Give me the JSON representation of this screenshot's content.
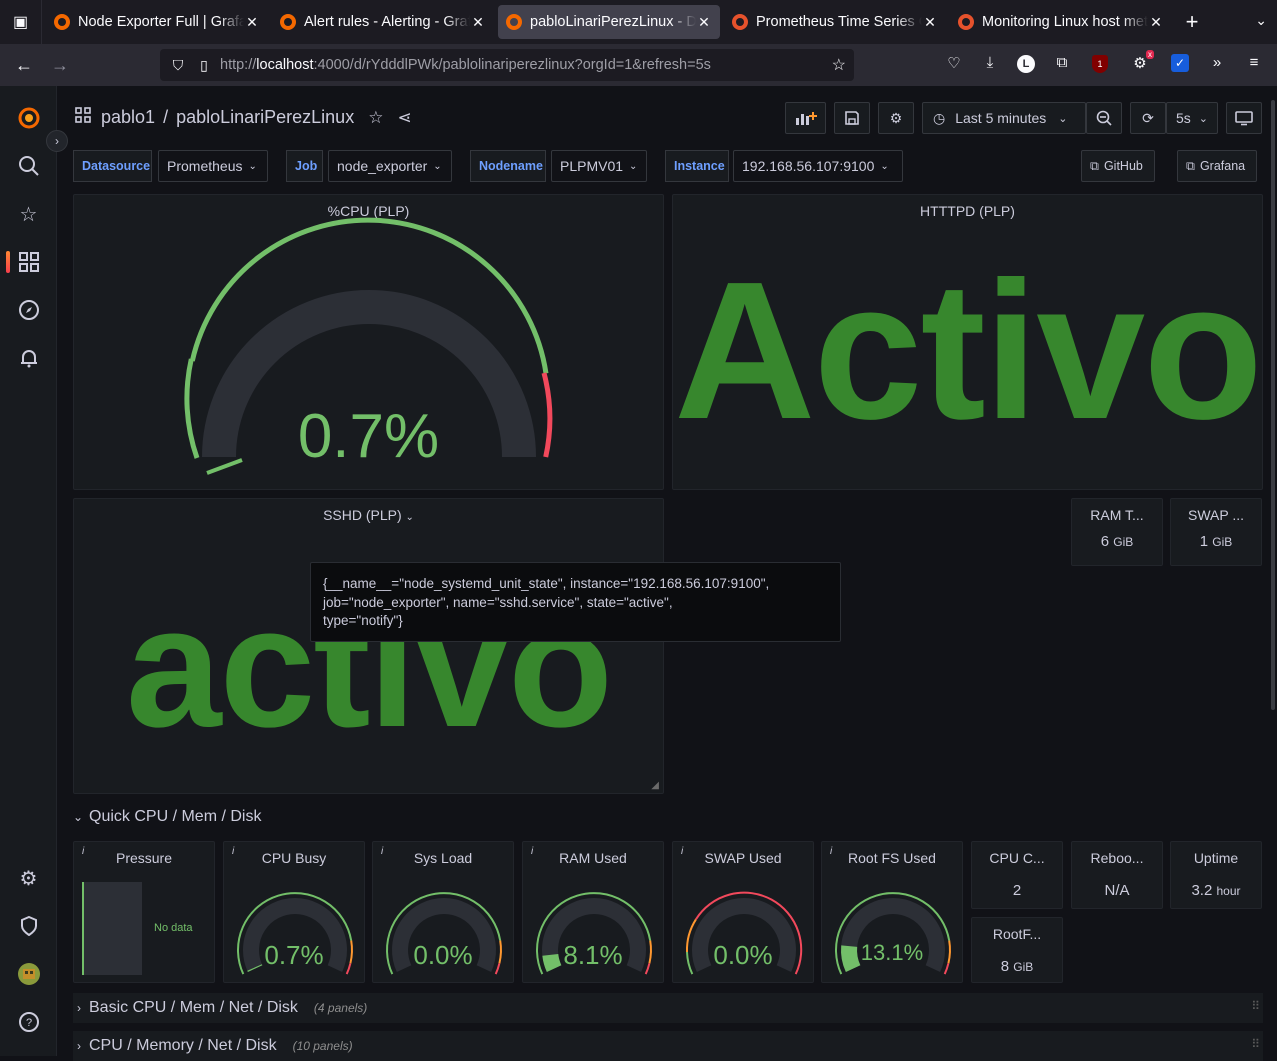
{
  "browser": {
    "tabs": [
      {
        "title": "Node Exporter Full | Grafana",
        "active": false,
        "icon": "grafana-icon"
      },
      {
        "title": "Alert rules - Alerting - Grafana",
        "active": false,
        "icon": "grafana-icon"
      },
      {
        "title": "pabloLinariPerezLinux - Dashboards",
        "active": true,
        "icon": "grafana-icon"
      },
      {
        "title": "Prometheus Time Series Collection",
        "active": false,
        "icon": "prometheus-icon"
      },
      {
        "title": "Monitoring Linux host metrics",
        "active": false,
        "icon": "prometheus-icon"
      }
    ],
    "url_host": "localhost",
    "url_prefix": "http://",
    "url_rest": ":4000/d/rYdddlPWk/pablolinariperezlinux?orgId=1&refresh=5s",
    "ext_badge": "1"
  },
  "dashboard": {
    "folder": "pablo1",
    "title": "pabloLinariPerezLinux",
    "time_range": "Last 5 minutes",
    "refresh": "5s"
  },
  "variables": [
    {
      "label": "Datasource",
      "value": "Prometheus"
    },
    {
      "label": "Job",
      "value": "node_exporter"
    },
    {
      "label": "Nodename",
      "value": "PLPMV01"
    },
    {
      "label": "Instance",
      "value": "192.168.56.107:9100"
    }
  ],
  "links": {
    "github": "GitHub",
    "grafana": "Grafana"
  },
  "panels": {
    "cpu": {
      "title": "%CPU (PLP)",
      "value": "0.7%",
      "percent": 0.7
    },
    "httpd": {
      "title": "HTTTPD (PLP)",
      "value": "Activo"
    },
    "sshd": {
      "title": "SSHD (PLP)",
      "value": "activo"
    },
    "ram_total": {
      "title": "RAM T...",
      "value": "6",
      "unit": "GiB"
    },
    "swap_total": {
      "title": "SWAP ...",
      "value": "1",
      "unit": "GiB"
    }
  },
  "tooltip": {
    "line1": "{__name__=\"node_systemd_unit_state\", instance=\"192.168.56.107:9100\",",
    "line2": "job=\"node_exporter\", name=\"sshd.service\", state=\"active\",",
    "line3": "type=\"notify\"}"
  },
  "rows": [
    {
      "title": "Quick CPU / Mem / Disk",
      "count": "",
      "expanded": true
    },
    {
      "title": "Basic CPU / Mem / Net / Disk",
      "count": "(4 panels)",
      "expanded": false
    },
    {
      "title": "CPU / Memory / Net / Disk",
      "count": "(10 panels)",
      "expanded": false
    }
  ],
  "quick": {
    "pressure": {
      "title": "Pressure",
      "nodata": "No data"
    },
    "cpu_busy": {
      "title": "CPU Busy",
      "value": "0.7%",
      "percent": 0.7
    },
    "sys_load": {
      "title": "Sys Load",
      "value": "0.0%",
      "percent": 0.0
    },
    "ram_used": {
      "title": "RAM Used",
      "value": "8.1%",
      "percent": 8.1
    },
    "swap_used": {
      "title": "SWAP Used",
      "value": "0.0%",
      "percent": 0.0
    },
    "rootfs_used": {
      "title": "Root FS Used",
      "value": "13.1%",
      "percent": 13.1
    },
    "cpu_cores": {
      "title": "CPU C...",
      "value": "2"
    },
    "reboot": {
      "title": "Reboo...",
      "value": "N/A"
    },
    "uptime": {
      "title": "Uptime",
      "value": "3.2",
      "unit": "hour"
    },
    "rootfs_total": {
      "title": "RootF...",
      "value": "8",
      "unit": "GiB"
    }
  },
  "colors": {
    "green": "#73bf69",
    "dark_green": "#37872d",
    "red": "#f2495c",
    "orange": "#ff9830",
    "accent": "#6e9fff"
  }
}
